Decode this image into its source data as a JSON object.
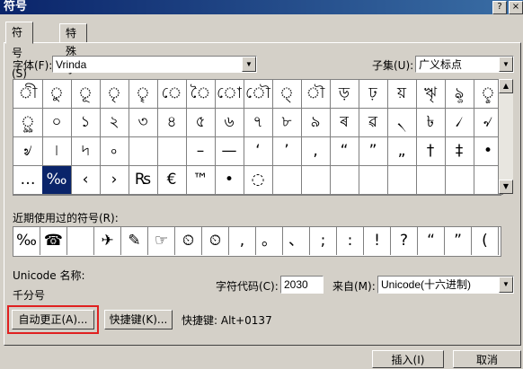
{
  "window": {
    "title": "符号",
    "help_glyph": "?",
    "close_glyph": "×"
  },
  "tabs": [
    "符号(S)",
    "特殊字符(P)"
  ],
  "font": {
    "label": "字体(F):",
    "value": "Vrinda"
  },
  "subset": {
    "label": "子集(U):",
    "value": "广义标点"
  },
  "symbol_grid": [
    [
      "ী",
      "ু",
      "ূ",
      "ৃ",
      "ৄ",
      "ে",
      "ৈ",
      "ো",
      "ৌ",
      "্",
      "ৗ",
      "ড়",
      "ঢ়",
      "য়",
      "ৠ",
      "ৡ",
      "ৢ"
    ],
    [
      "ৣ",
      "০",
      "১",
      "২",
      "৩",
      "৪",
      "৫",
      "৬",
      "৭",
      "৮",
      "৯",
      "ৰ",
      "ৱ",
      "৲",
      "৳",
      "৴",
      "৵"
    ],
    [
      "৶",
      "৷",
      "৸",
      "৹",
      "",
      "",
      "–",
      "—",
      "‘",
      "’",
      "‚",
      "“",
      "”",
      "„",
      "†",
      "‡",
      "•"
    ],
    [
      "…",
      "‰",
      "‹",
      "›",
      "₨",
      "€",
      "™",
      "•",
      "◌",
      "",
      "",
      "",
      "",
      "",
      "",
      "",
      ""
    ]
  ],
  "recent_label": "近期使用过的符号(R):",
  "recent_symbols": [
    "‰",
    "☎",
    "",
    "✈",
    "✎",
    "☞",
    "⏲",
    "⏲",
    ",",
    "。",
    "、",
    ";",
    ":",
    "!",
    "?",
    "“",
    "”",
    "("
  ],
  "unicode_name_label": "Unicode 名称:",
  "unicode_name_value": "千分号",
  "char_code_label": "字符代码(C):",
  "char_code_value": "2030",
  "from_label": "来自(M):",
  "from_value": "Unicode(十六进制)",
  "autocorrect_button": "自动更正(A)...",
  "shortcut_button": "快捷键(K)...",
  "shortcut_text": "快捷键: Alt+0137",
  "insert_button": "插入(I)",
  "cancel_button": "取消"
}
